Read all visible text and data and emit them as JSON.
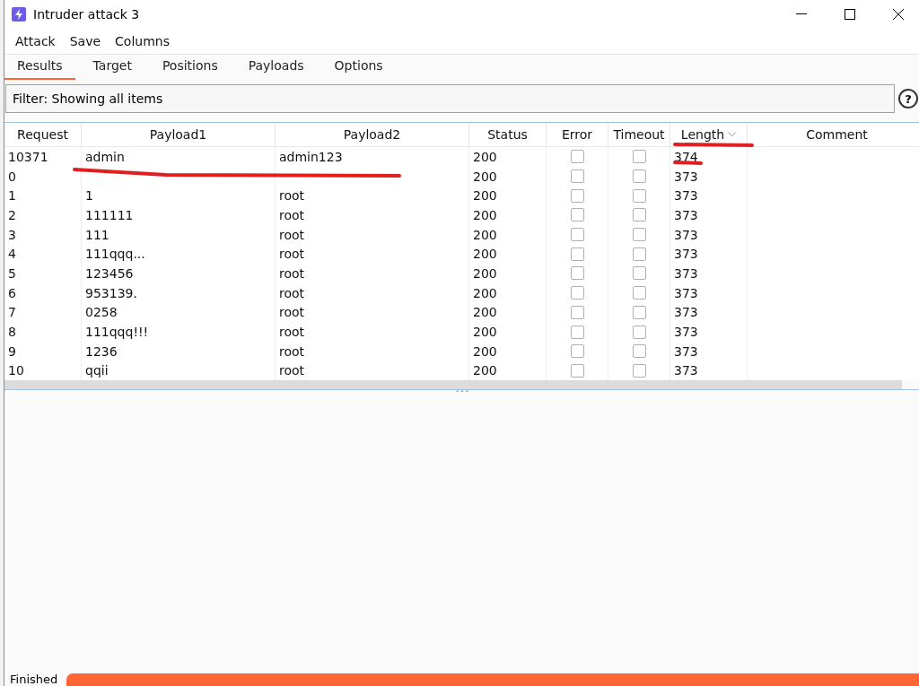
{
  "window": {
    "title": "Intruder attack 3"
  },
  "menu": [
    "Attack",
    "Save",
    "Columns"
  ],
  "tabs": [
    {
      "label": "Results",
      "selected": true
    },
    {
      "label": "Target",
      "selected": false
    },
    {
      "label": "Positions",
      "selected": false
    },
    {
      "label": "Payloads",
      "selected": false
    },
    {
      "label": "Options",
      "selected": false
    }
  ],
  "filter": {
    "value": "Filter: Showing all items",
    "help": "?"
  },
  "table": {
    "columns": [
      {
        "label": "Request",
        "sorted": false
      },
      {
        "label": "Payload1",
        "sorted": false
      },
      {
        "label": "Payload2",
        "sorted": false
      },
      {
        "label": "Status",
        "sorted": false
      },
      {
        "label": "Error",
        "sorted": false
      },
      {
        "label": "Timeout",
        "sorted": false
      },
      {
        "label": "Length",
        "sorted": true
      },
      {
        "label": "Comment",
        "sorted": false
      }
    ],
    "rows": [
      {
        "request": "10371",
        "payload1": "admin",
        "payload2": "admin123",
        "status": "200",
        "error": false,
        "timeout": false,
        "length": "374"
      },
      {
        "request": "0",
        "payload1": "",
        "payload2": "",
        "status": "200",
        "error": false,
        "timeout": false,
        "length": "373"
      },
      {
        "request": "1",
        "payload1": "1",
        "payload2": "root",
        "status": "200",
        "error": false,
        "timeout": false,
        "length": "373"
      },
      {
        "request": "2",
        "payload1": "111111",
        "payload2": "root",
        "status": "200",
        "error": false,
        "timeout": false,
        "length": "373"
      },
      {
        "request": "3",
        "payload1": "111",
        "payload2": "root",
        "status": "200",
        "error": false,
        "timeout": false,
        "length": "373"
      },
      {
        "request": "4",
        "payload1": "111qqq...",
        "payload2": "root",
        "status": "200",
        "error": false,
        "timeout": false,
        "length": "373"
      },
      {
        "request": "5",
        "payload1": "123456",
        "payload2": "root",
        "status": "200",
        "error": false,
        "timeout": false,
        "length": "373"
      },
      {
        "request": "6",
        "payload1": "953139.",
        "payload2": "root",
        "status": "200",
        "error": false,
        "timeout": false,
        "length": "373"
      },
      {
        "request": "7",
        "payload1": "0258",
        "payload2": "root",
        "status": "200",
        "error": false,
        "timeout": false,
        "length": "373"
      },
      {
        "request": "8",
        "payload1": "111qqq!!!",
        "payload2": "root",
        "status": "200",
        "error": false,
        "timeout": false,
        "length": "373"
      },
      {
        "request": "9",
        "payload1": "1236",
        "payload2": "root",
        "status": "200",
        "error": false,
        "timeout": false,
        "length": "373"
      },
      {
        "request": "10",
        "payload1": "qqii",
        "payload2": "root",
        "status": "200",
        "error": false,
        "timeout": false,
        "length": "373"
      }
    ]
  },
  "status_bar": {
    "text": "Finished",
    "level": 1
  }
}
